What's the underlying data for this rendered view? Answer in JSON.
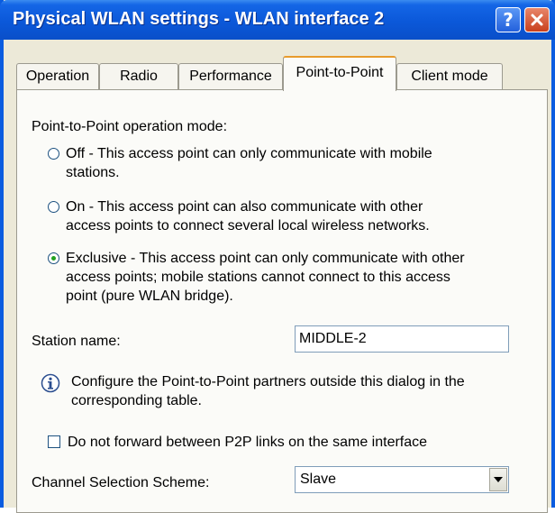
{
  "window": {
    "title": "Physical WLAN settings - WLAN interface 2",
    "help_glyph": "?"
  },
  "tabs": [
    {
      "label": "Operation"
    },
    {
      "label": "Radio"
    },
    {
      "label": "Performance"
    },
    {
      "label": "Point-to-Point",
      "active": true
    },
    {
      "label": "Client mode"
    }
  ],
  "p2p": {
    "mode_label": "Point-to-Point operation mode:",
    "options": [
      {
        "line1": "Off - This access point can only communicate with mobile",
        "line2": "stations.",
        "selected": false
      },
      {
        "line1": "On - This access point can also communicate with other",
        "line2": "access points to connect several local wireless networks.",
        "selected": false
      },
      {
        "line1": "Exclusive - This access point can only communicate with other",
        "line2": "access points; mobile stations cannot connect to this access",
        "line3": "point (pure WLAN bridge).",
        "selected": true
      }
    ],
    "station_label": "Station name:",
    "station_value": "MIDDLE-2",
    "info_line1": "Configure the Point-to-Point partners outside this dialog in the",
    "info_line2": "corresponding table.",
    "no_forward_label": "Do not forward between P2P links on the same interface",
    "no_forward_checked": false,
    "channel_label": "Channel Selection Scheme:",
    "channel_value": "Slave"
  },
  "colors": {
    "titlebar": "#0b58d9",
    "dialog_bg": "#ece9d8",
    "active_tab_accent": "#e89b2c",
    "radio_dot": "#21a121"
  },
  "icons": [
    "help-icon",
    "close-icon",
    "info-icon",
    "dropdown-arrow-icon"
  ]
}
